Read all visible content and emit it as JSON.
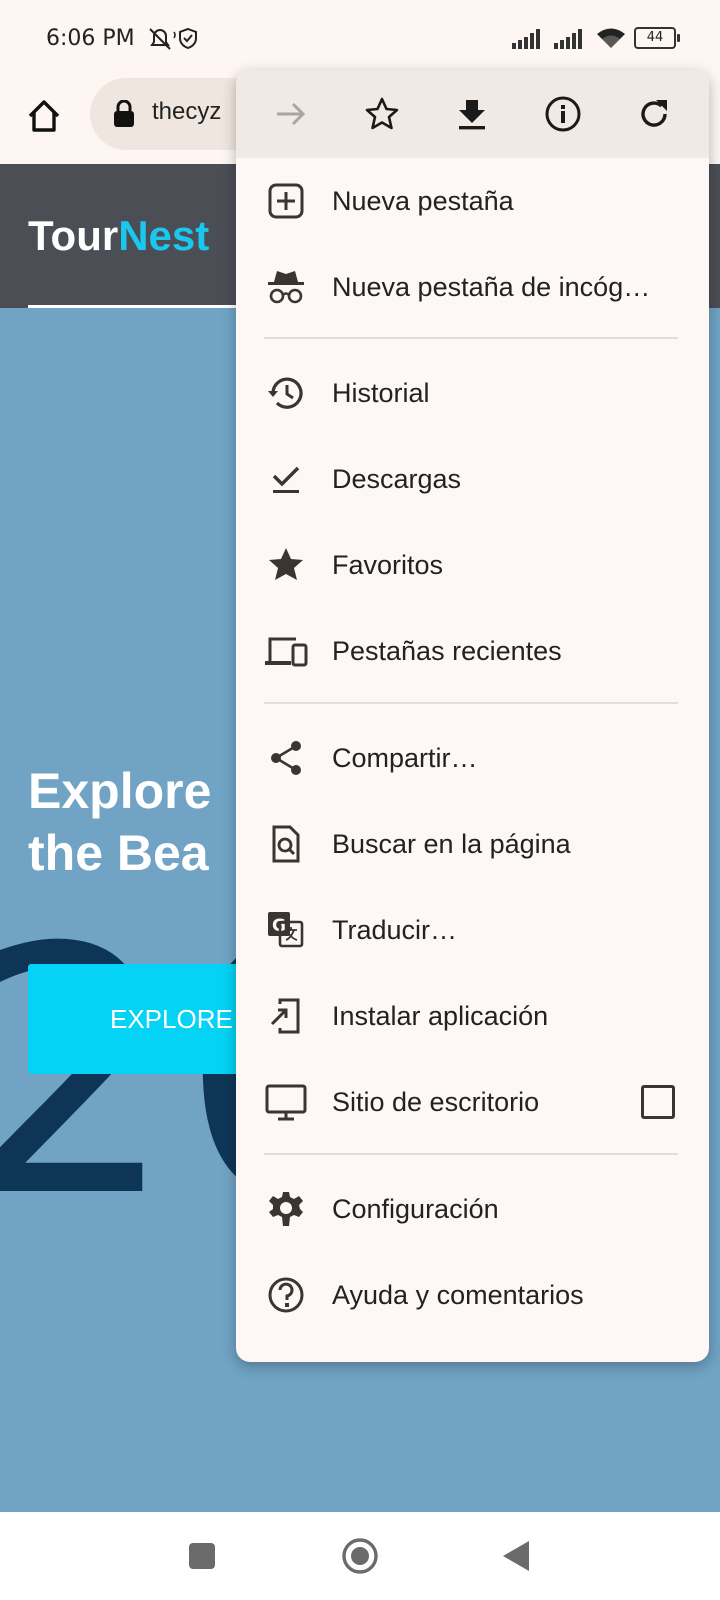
{
  "status_bar": {
    "time": "6:06 PM",
    "battery": "44"
  },
  "toolbar": {
    "url": "thecyz"
  },
  "page": {
    "logo_part1": "Tour",
    "logo_part2": "Nest",
    "hero_line1": "Explore",
    "hero_line2": "the Bea",
    "big_year": "20",
    "explore_button": "EXPLORE"
  },
  "menu": {
    "top_icons": [
      "forward-icon",
      "bookmark-star-icon",
      "download-icon",
      "info-icon",
      "refresh-icon"
    ],
    "items": [
      {
        "label": "Nueva pestaña",
        "icon": "new-tab-icon"
      },
      {
        "label": "Nueva pestaña de incóg…",
        "icon": "incognito-icon"
      },
      {
        "label": "Historial",
        "icon": "history-icon"
      },
      {
        "label": "Descargas",
        "icon": "downloads-icon"
      },
      {
        "label": "Favoritos",
        "icon": "star-icon"
      },
      {
        "label": "Pestañas recientes",
        "icon": "devices-icon"
      },
      {
        "label": "Compartir…",
        "icon": "share-icon"
      },
      {
        "label": "Buscar en la página",
        "icon": "find-in-page-icon"
      },
      {
        "label": "Traducir…",
        "icon": "translate-icon"
      },
      {
        "label": "Instalar aplicación",
        "icon": "install-app-icon"
      },
      {
        "label": "Sitio de escritorio",
        "icon": "desktop-icon",
        "checked": false
      },
      {
        "label": "Configuración",
        "icon": "gear-icon"
      },
      {
        "label": "Ayuda y comentarios",
        "icon": "help-icon"
      }
    ]
  },
  "colors": {
    "accent": "#1ac8ef",
    "button": "#04d3f5",
    "page_bg": "#70a3c4",
    "header_bg": "#4b4e55"
  }
}
